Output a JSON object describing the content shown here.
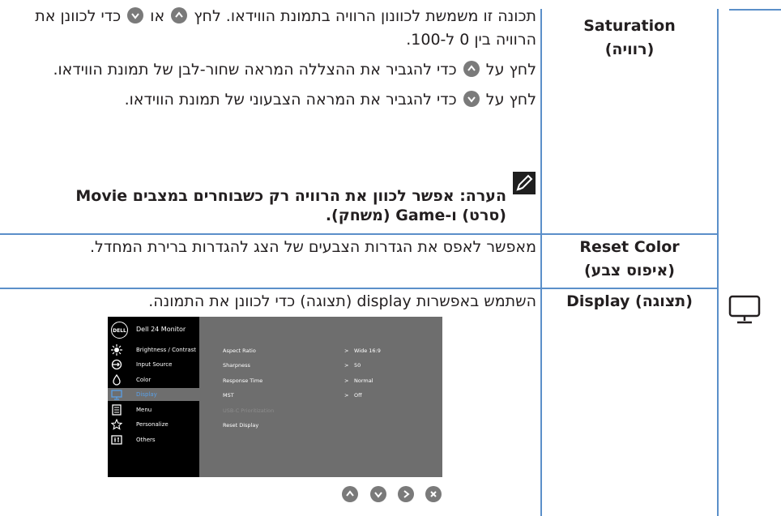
{
  "rows": [
    {
      "label": "Saturation",
      "label_he": "(רוויה)",
      "para1_a": "תכונה זו משמשת לכוונון הרוויה בתמונת הווידאו. לחץ",
      "para1_b": "או",
      "para1_c": "כדי לכוונן את הרוויה בין 0 ל-100.",
      "para2_a": "לחץ על",
      "para2_b": "כדי להגביר את ההצללה המראה שחור-לבן של תמונת הווידאו.",
      "para3_a": "לחץ על",
      "para3_b": "כדי להגביר את המראה הצבעוני של תמונת הווידאו.",
      "note": "הערה: אפשר לכוון את הרוויה רק כשבוחרים במצבים Movie (סרט) ו-Game (משחק)."
    },
    {
      "label": "Reset Color",
      "label_he": "(איפוס צבע)",
      "text": "מאפשר לאפס את הגדרות הצבעים של הצג להגדרות ברירת המחדל."
    },
    {
      "label": "Display (תצוגה)",
      "text": "השתמש באפשרות display (תצוגה) כדי לכוונן את התמונה."
    }
  ],
  "osd": {
    "logo": "DELL",
    "title": "Dell 24 Monitor",
    "menu": [
      {
        "label": "Brightness / Contrast",
        "icon": "brightness-icon"
      },
      {
        "label": "Input Source",
        "icon": "input-source-icon"
      },
      {
        "label": "Color",
        "icon": "color-icon"
      },
      {
        "label": "Display",
        "icon": "display-icon",
        "active": true
      },
      {
        "label": "Menu",
        "icon": "menu-icon"
      },
      {
        "label": "Personalize",
        "icon": "star-icon"
      },
      {
        "label": "Others",
        "icon": "others-icon"
      }
    ],
    "settings": [
      {
        "label": "Aspect Ratio",
        "arrow": ">",
        "value": "Wide 16:9"
      },
      {
        "label": "Sharpness",
        "arrow": ">",
        "value": "50"
      },
      {
        "label": "Response Time",
        "arrow": ">",
        "value": "Normal"
      },
      {
        "label": "MST",
        "arrow": ">",
        "value": "Off"
      },
      {
        "label": "USB-C Prioritization",
        "arrow": "",
        "value": "",
        "dimmed": true
      },
      {
        "label": "Reset Display",
        "arrow": "",
        "value": ""
      }
    ]
  },
  "nav_buttons": [
    "up-icon",
    "down-icon",
    "right-icon",
    "close-icon"
  ],
  "colors": {
    "rule": "#5b8fc9",
    "osd_panel": "#6e6e6e",
    "osd_highlight": "#5aa0e6",
    "button": "#7a7a7a"
  }
}
